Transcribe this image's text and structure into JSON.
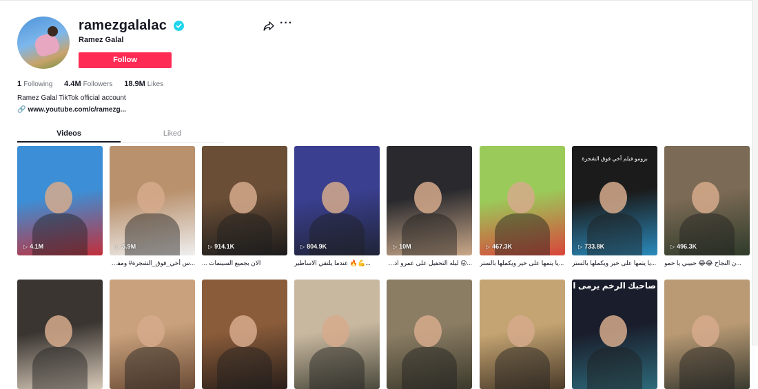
{
  "profile": {
    "username": "ramezgalalac",
    "nickname": "Ramez Galal",
    "follow_label": "Follow",
    "bio": "Ramez Galal TikTok official account",
    "link": "www.youtube.com/c/ramezg...",
    "stats": {
      "following_count": "1",
      "following_label": "Following",
      "followers_count": "4.4M",
      "followers_label": "Followers",
      "likes_count": "18.9M",
      "likes_label": "Likes"
    }
  },
  "tabs": [
    "Videos",
    "Liked"
  ],
  "videos_row1": [
    {
      "views": "4.1M",
      "caption": "",
      "colors": [
        "#3c8fd6",
        "#c22f3a"
      ]
    },
    {
      "views": "5.9M",
      "caption": "...س أخي_فوق_الشجرة# ومفاجأة",
      "colors": [
        "#b9916d",
        "#efefef"
      ]
    },
    {
      "views": "914.1K",
      "caption": "الان بجميع السينمات ...",
      "colors": [
        "#6a4e36",
        "#1c1b1b"
      ]
    },
    {
      "views": "804.9K",
      "caption": "...💪🔥 عندما يلتقي الاساطير",
      "colors": [
        "#3a3f8f",
        "#1f2437"
      ]
    },
    {
      "views": "10M",
      "caption": "...😜 ليله التحفيل على عمرو اديب",
      "colors": [
        "#2a2a2e",
        "#caa889"
      ]
    },
    {
      "views": "467.3K",
      "caption": "...يا يتمها على خير ويكملها بالستر",
      "colors": [
        "#9acb5a",
        "#d9453a"
      ]
    },
    {
      "views": "733.8K",
      "caption": "...يا يتمها على خير ويكملها بالستر",
      "colors": [
        "#1b1b1b",
        "#2a8bbd"
      ],
      "overlay": "برومو فيلم أخي فوق الشجرة"
    },
    {
      "views": "496.3K",
      "caption": "...ن النجاح 😂😂 حبيبي يا حمو",
      "colors": [
        "#7b6a55",
        "#2f3b2a"
      ]
    }
  ],
  "videos_row2": [
    {
      "colors": [
        "#3a3531",
        "#d7c9b8"
      ]
    },
    {
      "colors": [
        "#c9a17c",
        "#6b4c36"
      ]
    },
    {
      "colors": [
        "#8a5c3a",
        "#2a1f1a"
      ]
    },
    {
      "colors": [
        "#c9b8a0",
        "#4a4a3c"
      ]
    },
    {
      "colors": [
        "#8b7d64",
        "#3c3a2c"
      ]
    },
    {
      "colors": [
        "#c4a472",
        "#4a3b2a"
      ]
    },
    {
      "colors": [
        "#1a1d2b",
        "#2d6a7a"
      ],
      "overlay": "صاحبك الرخم يرمى اي"
    },
    {
      "colors": [
        "#b99a74",
        "#3a3a30"
      ]
    }
  ]
}
